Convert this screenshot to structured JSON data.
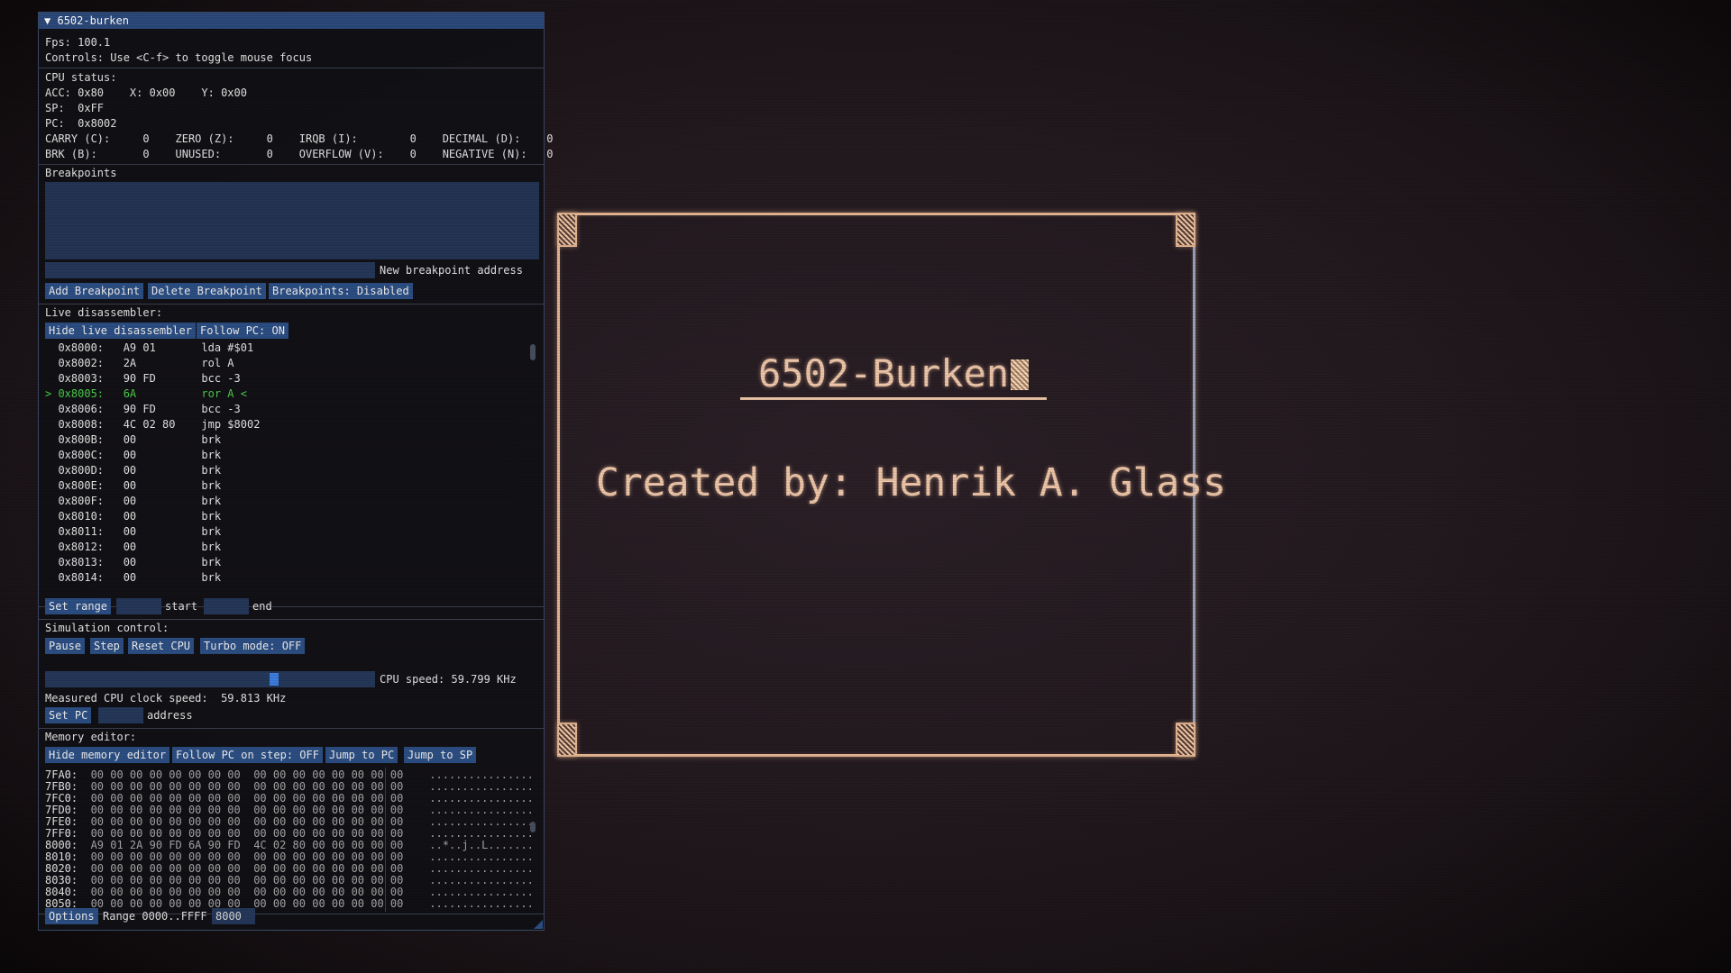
{
  "window": {
    "title": "6502-burken",
    "fps_label": "Fps: 100.1",
    "controls_hint": "Controls: Use <C-f> to toggle mouse focus"
  },
  "cpu_status": {
    "heading": "CPU status:",
    "line_acc": "ACC: 0x80    X: 0x00    Y: 0x00",
    "line_sp": "SP:  0xFF",
    "line_pc": "PC:  0x8002",
    "line_flags1": "CARRY (C):     0    ZERO (Z):     0    IRQB (I):        0    DECIMAL (D):    0",
    "line_flags2": "BRK (B):       0    UNUSED:       0    OVERFLOW (V):    0    NEGATIVE (N):   0"
  },
  "breakpoints": {
    "heading": "Breakpoints",
    "address_input": "",
    "address_label": "New breakpoint address",
    "add_button": "Add Breakpoint",
    "delete_button": "Delete Breakpoint",
    "toggle_button": "Breakpoints: Disabled"
  },
  "disassembler": {
    "heading": "Live disassembler:",
    "hide_button": "Hide live disassembler",
    "follow_button": "Follow PC: ON",
    "rows": [
      "  0x8000:   A9 01       lda #$01",
      "  0x8002:   2A          rol A",
      "  0x8003:   90 FD       bcc -3",
      "> 0x8005:   6A          ror A <",
      "  0x8006:   90 FD       bcc -3",
      "  0x8008:   4C 02 80    jmp $8002",
      "  0x800B:   00          brk",
      "  0x800C:   00          brk",
      "  0x800D:   00          brk",
      "  0x800E:   00          brk",
      "  0x800F:   00          brk",
      "  0x8010:   00          brk",
      "  0x8011:   00          brk",
      "  0x8012:   00          brk",
      "  0x8013:   00          brk",
      "  0x8014:   00          brk"
    ],
    "current_row_index": 3,
    "set_range_button": "Set range",
    "start_input": "",
    "start_label": "start",
    "end_input": "",
    "end_label": "end"
  },
  "simulation": {
    "heading": "Simulation control:",
    "pause_button": "Pause",
    "step_button": "Step",
    "reset_button": "Reset CPU",
    "turbo_button": "Turbo mode: OFF",
    "speed_label": "CPU speed: 59.799 KHz",
    "speed_slider_fraction": 0.7,
    "measured_label": "Measured CPU clock speed:  59.813 KHz",
    "set_pc_button": "Set PC",
    "pc_input": "",
    "pc_label": "address"
  },
  "memory_editor": {
    "heading": "Memory editor:",
    "hide_button": "Hide memory editor",
    "follow_button": "Follow PC on step: OFF",
    "jump_pc_button": "Jump to PC",
    "jump_sp_button": "Jump to SP",
    "rows": [
      {
        "addr": "7FA0:",
        "bytes": "00 00 00 00 00 00 00 00  00 00 00 00 00 00 00 00",
        "ascii": "................"
      },
      {
        "addr": "7FB0:",
        "bytes": "00 00 00 00 00 00 00 00  00 00 00 00 00 00 00 00",
        "ascii": "................"
      },
      {
        "addr": "7FC0:",
        "bytes": "00 00 00 00 00 00 00 00  00 00 00 00 00 00 00 00",
        "ascii": "................"
      },
      {
        "addr": "7FD0:",
        "bytes": "00 00 00 00 00 00 00 00  00 00 00 00 00 00 00 00",
        "ascii": "................"
      },
      {
        "addr": "7FE0:",
        "bytes": "00 00 00 00 00 00 00 00  00 00 00 00 00 00 00 00",
        "ascii": "................"
      },
      {
        "addr": "7FF0:",
        "bytes": "00 00 00 00 00 00 00 00  00 00 00 00 00 00 00 00",
        "ascii": "................"
      },
      {
        "addr": "8000:",
        "bytes": "A9 01 2A 90 FD 6A 90 FD  4C 02 80 00 00 00 00 00",
        "ascii": "..*..j..L......."
      },
      {
        "addr": "8010:",
        "bytes": "00 00 00 00 00 00 00 00  00 00 00 00 00 00 00 00",
        "ascii": "................"
      },
      {
        "addr": "8020:",
        "bytes": "00 00 00 00 00 00 00 00  00 00 00 00 00 00 00 00",
        "ascii": "................"
      },
      {
        "addr": "8030:",
        "bytes": "00 00 00 00 00 00 00 00  00 00 00 00 00 00 00 00",
        "ascii": "................"
      },
      {
        "addr": "8040:",
        "bytes": "00 00 00 00 00 00 00 00  00 00 00 00 00 00 00 00",
        "ascii": "................"
      },
      {
        "addr": "8050:",
        "bytes": "00 00 00 00 00 00 00 00  00 00 00 00 00 00 00 00",
        "ascii": "................"
      }
    ],
    "options_button": "Options",
    "range_label": "Range 0000..FFFF",
    "goto_input": "8000"
  },
  "screen": {
    "title": "6502-Burken",
    "credit": "Created by: Henrik A. Glass"
  },
  "colors": {
    "accent": "#2c4f84",
    "title_bar": "#2c4a7c",
    "current_line": "#4ccf4c",
    "screen_text": "#f0c8aa"
  }
}
